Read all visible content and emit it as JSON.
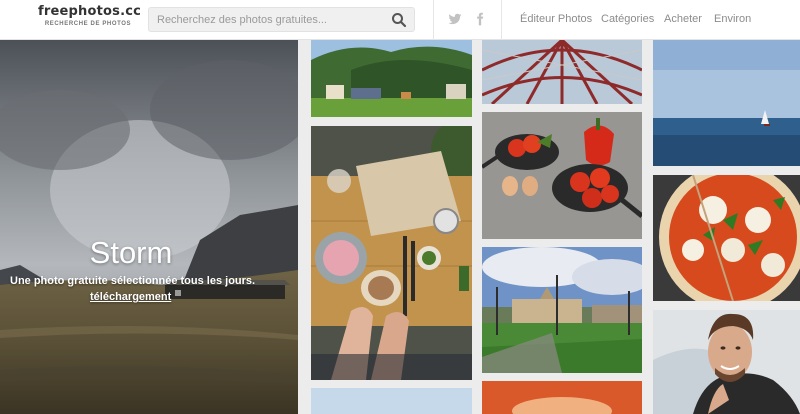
{
  "header": {
    "logo": "freephotos.cc",
    "logo_tagline": "RECHERCHE DE PHOTOS",
    "search_placeholder": "Recherchez des photos gratuites...",
    "nav": [
      "Éditeur Photos",
      "Catégories",
      "Acheter",
      "Environ"
    ],
    "social_icons": [
      "twitter-icon",
      "facebook-icon"
    ]
  },
  "hero": {
    "title": "Storm",
    "subtitle": "Une photo gratuite sélectionnée tous les jours.",
    "link": "téléchargement"
  },
  "colors": {
    "header_bg": "#ffffff",
    "page_bg": "#ececec",
    "nav_text": "#8c8c8c"
  }
}
